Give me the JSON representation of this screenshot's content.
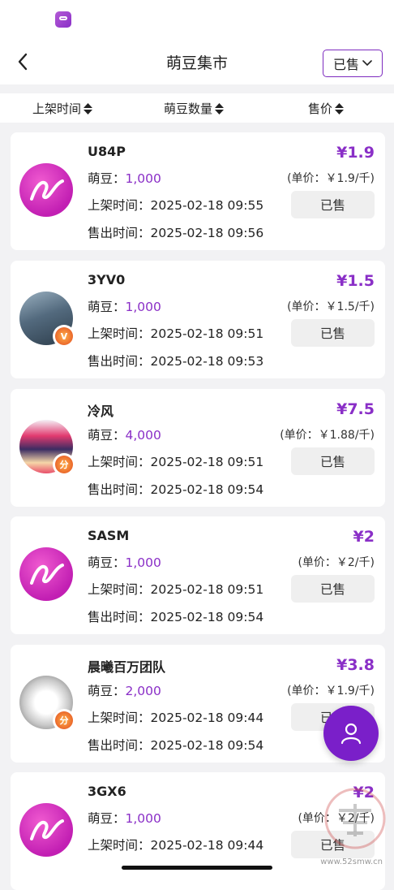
{
  "nav": {
    "title": "萌豆集市",
    "filter_label": "已售"
  },
  "sort_headers": [
    "上架时间",
    "萌豆数量",
    "售价"
  ],
  "labels": {
    "beans": "萌豆：",
    "list_time": "上架时间：",
    "sold_time": "售出时间：",
    "sold_button": "已售"
  },
  "listings": [
    {
      "name": "U84P",
      "beans": "1,000",
      "price": "¥1.9",
      "unit_price": "(单价：￥1.9/千)",
      "list_time": "2025-02-18 09:55",
      "sold_time": "2025-02-18 09:56"
    },
    {
      "name": "3YV0",
      "beans": "1,000",
      "price": "¥1.5",
      "unit_price": "(单价：￥1.5/千)",
      "list_time": "2025-02-18 09:51",
      "sold_time": "2025-02-18 09:53"
    },
    {
      "name": "冷风",
      "beans": "4,000",
      "price": "¥7.5",
      "unit_price": "(单价：￥1.88/千)",
      "list_time": "2025-02-18 09:51",
      "sold_time": "2025-02-18 09:54"
    },
    {
      "name": "SASM",
      "beans": "1,000",
      "price": "¥2",
      "unit_price": "(单价：￥2/千)",
      "list_time": "2025-02-18 09:51",
      "sold_time": "2025-02-18 09:54"
    },
    {
      "name": "晨曦百万团队",
      "beans": "2,000",
      "price": "¥3.8",
      "unit_price": "(单价：￥1.9/千)",
      "list_time": "2025-02-18 09:44",
      "sold_time": "2025-02-18 09:54"
    },
    {
      "name": "3GX6",
      "beans": "1,000",
      "price": "¥2",
      "unit_price": "(单价：￥2/千)",
      "list_time": "2025-02-18 09:44",
      "sold_time": ""
    }
  ],
  "badges": {
    "v": "V",
    "fen": "分"
  },
  "watermark_text": "www.52smw.cn",
  "colors": {
    "accent": "#8a2fc7",
    "fab": "#7a1fc9"
  }
}
